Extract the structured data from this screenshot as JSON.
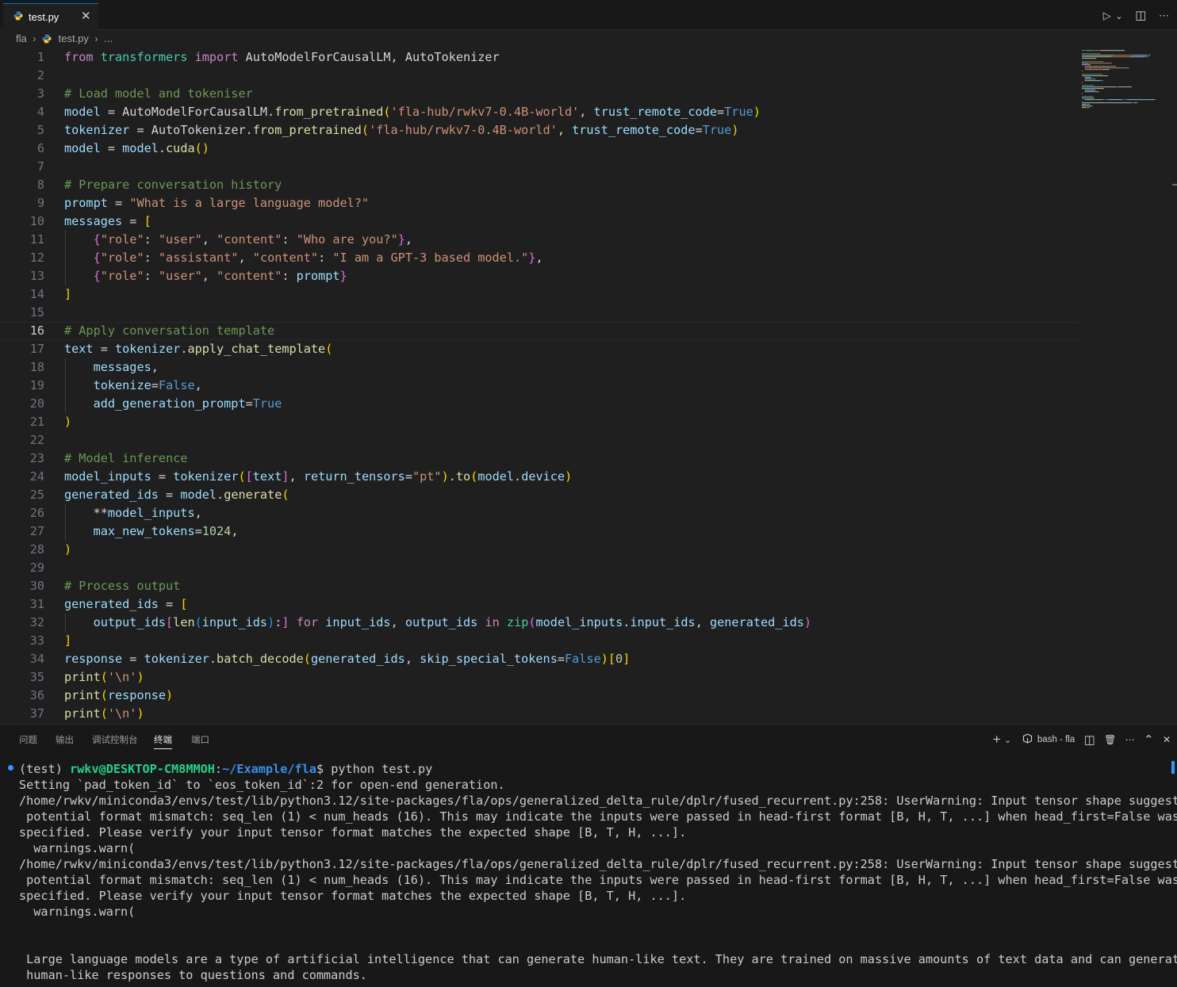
{
  "tab": {
    "filename": "test.py",
    "close_glyph": "✕"
  },
  "editor_actions": {
    "run": "▷",
    "run_menu": "⌄",
    "split": "◫",
    "more": "⋯"
  },
  "breadcrumb": {
    "folder": "fla",
    "file": "test.py",
    "more": "..."
  },
  "code_lines": [
    {
      "n": "1",
      "tokens": [
        [
          "kw",
          "from"
        ],
        [
          "plain",
          " "
        ],
        [
          "mod",
          "transformers"
        ],
        [
          "plain",
          " "
        ],
        [
          "kw",
          "import"
        ],
        [
          "plain",
          " "
        ],
        [
          "cls",
          "AutoModelForCausalLM"
        ],
        [
          "plain",
          ", "
        ],
        [
          "cls",
          "AutoTokenizer"
        ]
      ]
    },
    {
      "n": "2",
      "tokens": []
    },
    {
      "n": "3",
      "tokens": [
        [
          "cmt",
          "# Load model and tokeniser"
        ]
      ]
    },
    {
      "n": "4",
      "tokens": [
        [
          "var",
          "model"
        ],
        [
          "op",
          " = "
        ],
        [
          "cls",
          "AutoModelForCausalLM"
        ],
        [
          "plain",
          "."
        ],
        [
          "fn",
          "from_pretrained"
        ],
        [
          "b1",
          "("
        ],
        [
          "str",
          "'fla-hub/rwkv7-0.4B-world'"
        ],
        [
          "plain",
          ", "
        ],
        [
          "var",
          "trust_remote_code"
        ],
        [
          "op",
          "="
        ],
        [
          "bool",
          "True"
        ],
        [
          "b1",
          ")"
        ]
      ]
    },
    {
      "n": "5",
      "tokens": [
        [
          "var",
          "tokenizer"
        ],
        [
          "op",
          " = "
        ],
        [
          "cls",
          "AutoTokenizer"
        ],
        [
          "plain",
          "."
        ],
        [
          "fn",
          "from_pretrained"
        ],
        [
          "b1",
          "("
        ],
        [
          "str",
          "'fla-hub/rwkv7-0.4B-world'"
        ],
        [
          "plain",
          ", "
        ],
        [
          "var",
          "trust_remote_code"
        ],
        [
          "op",
          "="
        ],
        [
          "bool",
          "True"
        ],
        [
          "b1",
          ")"
        ]
      ]
    },
    {
      "n": "6",
      "tokens": [
        [
          "var",
          "model"
        ],
        [
          "op",
          " = "
        ],
        [
          "var",
          "model"
        ],
        [
          "plain",
          "."
        ],
        [
          "fn",
          "cuda"
        ],
        [
          "b1",
          "()"
        ]
      ]
    },
    {
      "n": "7",
      "tokens": []
    },
    {
      "n": "8",
      "tokens": [
        [
          "cmt",
          "# Prepare conversation history"
        ]
      ]
    },
    {
      "n": "9",
      "tokens": [
        [
          "var",
          "prompt"
        ],
        [
          "op",
          " = "
        ],
        [
          "str",
          "\"What is a large language model?\""
        ]
      ]
    },
    {
      "n": "10",
      "tokens": [
        [
          "var",
          "messages"
        ],
        [
          "op",
          " = "
        ],
        [
          "b1",
          "["
        ]
      ]
    },
    {
      "n": "11",
      "tokens": [
        [
          "plain",
          "    "
        ],
        [
          "b2",
          "{"
        ],
        [
          "str",
          "\"role\""
        ],
        [
          "plain",
          ": "
        ],
        [
          "str",
          "\"user\""
        ],
        [
          "plain",
          ", "
        ],
        [
          "str",
          "\"content\""
        ],
        [
          "plain",
          ": "
        ],
        [
          "str",
          "\"Who are you?\""
        ],
        [
          "b2",
          "}"
        ],
        [
          "plain",
          ","
        ]
      ]
    },
    {
      "n": "12",
      "tokens": [
        [
          "plain",
          "    "
        ],
        [
          "b2",
          "{"
        ],
        [
          "str",
          "\"role\""
        ],
        [
          "plain",
          ": "
        ],
        [
          "str",
          "\"assistant\""
        ],
        [
          "plain",
          ", "
        ],
        [
          "str",
          "\"content\""
        ],
        [
          "plain",
          ": "
        ],
        [
          "str",
          "\"I am a GPT-3 based model.\""
        ],
        [
          "b2",
          "}"
        ],
        [
          "plain",
          ","
        ]
      ]
    },
    {
      "n": "13",
      "tokens": [
        [
          "plain",
          "    "
        ],
        [
          "b2",
          "{"
        ],
        [
          "str",
          "\"role\""
        ],
        [
          "plain",
          ": "
        ],
        [
          "str",
          "\"user\""
        ],
        [
          "plain",
          ", "
        ],
        [
          "str",
          "\"content\""
        ],
        [
          "plain",
          ": "
        ],
        [
          "var",
          "prompt"
        ],
        [
          "b2",
          "}"
        ]
      ]
    },
    {
      "n": "14",
      "tokens": [
        [
          "b1",
          "]"
        ]
      ]
    },
    {
      "n": "15",
      "tokens": []
    },
    {
      "n": "16",
      "tokens": [
        [
          "cmt",
          "# Apply conversation template"
        ]
      ]
    },
    {
      "n": "17",
      "tokens": [
        [
          "var",
          "text"
        ],
        [
          "op",
          " = "
        ],
        [
          "var",
          "tokenizer"
        ],
        [
          "plain",
          "."
        ],
        [
          "fn",
          "apply_chat_template"
        ],
        [
          "b1",
          "("
        ]
      ]
    },
    {
      "n": "18",
      "tokens": [
        [
          "plain",
          "    "
        ],
        [
          "var",
          "messages"
        ],
        [
          "plain",
          ","
        ]
      ]
    },
    {
      "n": "19",
      "tokens": [
        [
          "plain",
          "    "
        ],
        [
          "var",
          "tokenize"
        ],
        [
          "op",
          "="
        ],
        [
          "bool",
          "False"
        ],
        [
          "plain",
          ","
        ]
      ]
    },
    {
      "n": "20",
      "tokens": [
        [
          "plain",
          "    "
        ],
        [
          "var",
          "add_generation_prompt"
        ],
        [
          "op",
          "="
        ],
        [
          "bool",
          "True"
        ]
      ]
    },
    {
      "n": "21",
      "tokens": [
        [
          "b1",
          ")"
        ]
      ]
    },
    {
      "n": "22",
      "tokens": []
    },
    {
      "n": "23",
      "tokens": [
        [
          "cmt",
          "# Model inference"
        ]
      ]
    },
    {
      "n": "24",
      "tokens": [
        [
          "var",
          "model_inputs"
        ],
        [
          "op",
          " = "
        ],
        [
          "var",
          "tokenizer"
        ],
        [
          "b1",
          "("
        ],
        [
          "b2",
          "["
        ],
        [
          "var",
          "text"
        ],
        [
          "b2",
          "]"
        ],
        [
          "plain",
          ", "
        ],
        [
          "var",
          "return_tensors"
        ],
        [
          "op",
          "="
        ],
        [
          "str",
          "\"pt\""
        ],
        [
          "b1",
          ")"
        ],
        [
          "plain",
          "."
        ],
        [
          "fn",
          "to"
        ],
        [
          "b1",
          "("
        ],
        [
          "var",
          "model"
        ],
        [
          "plain",
          "."
        ],
        [
          "var",
          "device"
        ],
        [
          "b1",
          ")"
        ]
      ]
    },
    {
      "n": "25",
      "tokens": [
        [
          "var",
          "generated_ids"
        ],
        [
          "op",
          " = "
        ],
        [
          "var",
          "model"
        ],
        [
          "plain",
          "."
        ],
        [
          "fn",
          "generate"
        ],
        [
          "b1",
          "("
        ]
      ]
    },
    {
      "n": "26",
      "tokens": [
        [
          "plain",
          "    "
        ],
        [
          "op",
          "**"
        ],
        [
          "var",
          "model_inputs"
        ],
        [
          "plain",
          ","
        ]
      ]
    },
    {
      "n": "27",
      "tokens": [
        [
          "plain",
          "    "
        ],
        [
          "var",
          "max_new_tokens"
        ],
        [
          "op",
          "="
        ],
        [
          "num",
          "1024"
        ],
        [
          "plain",
          ","
        ]
      ]
    },
    {
      "n": "28",
      "tokens": [
        [
          "b1",
          ")"
        ]
      ]
    },
    {
      "n": "29",
      "tokens": []
    },
    {
      "n": "30",
      "tokens": [
        [
          "cmt",
          "# Process output"
        ]
      ]
    },
    {
      "n": "31",
      "tokens": [
        [
          "var",
          "generated_ids"
        ],
        [
          "op",
          " = "
        ],
        [
          "b1",
          "["
        ]
      ]
    },
    {
      "n": "32",
      "tokens": [
        [
          "plain",
          "    "
        ],
        [
          "var",
          "output_ids"
        ],
        [
          "b2",
          "["
        ],
        [
          "fn",
          "len"
        ],
        [
          "b3",
          "("
        ],
        [
          "var",
          "input_ids"
        ],
        [
          "b3",
          ")"
        ],
        [
          "plain",
          ":"
        ],
        [
          "b2",
          "]"
        ],
        [
          "plain",
          " "
        ],
        [
          "kw",
          "for"
        ],
        [
          "plain",
          " "
        ],
        [
          "var",
          "input_ids"
        ],
        [
          "plain",
          ", "
        ],
        [
          "var",
          "output_ids"
        ],
        [
          "plain",
          " "
        ],
        [
          "kw",
          "in"
        ],
        [
          "plain",
          " "
        ],
        [
          "mod",
          "zip"
        ],
        [
          "b2",
          "("
        ],
        [
          "var",
          "model_inputs"
        ],
        [
          "plain",
          "."
        ],
        [
          "var",
          "input_ids"
        ],
        [
          "plain",
          ", "
        ],
        [
          "var",
          "generated_ids"
        ],
        [
          "b2",
          ")"
        ]
      ]
    },
    {
      "n": "33",
      "tokens": [
        [
          "b1",
          "]"
        ]
      ]
    },
    {
      "n": "34",
      "tokens": [
        [
          "var",
          "response"
        ],
        [
          "op",
          " = "
        ],
        [
          "var",
          "tokenizer"
        ],
        [
          "plain",
          "."
        ],
        [
          "fn",
          "batch_decode"
        ],
        [
          "b1",
          "("
        ],
        [
          "var",
          "generated_ids"
        ],
        [
          "plain",
          ", "
        ],
        [
          "var",
          "skip_special_tokens"
        ],
        [
          "op",
          "="
        ],
        [
          "bool",
          "False"
        ],
        [
          "b1",
          ")"
        ],
        [
          "b1",
          "["
        ],
        [
          "num",
          "0"
        ],
        [
          "b1",
          "]"
        ]
      ]
    },
    {
      "n": "35",
      "tokens": [
        [
          "fn",
          "print"
        ],
        [
          "b1",
          "("
        ],
        [
          "str",
          "'\\n'"
        ],
        [
          "b1",
          ")"
        ]
      ]
    },
    {
      "n": "36",
      "tokens": [
        [
          "fn",
          "print"
        ],
        [
          "b1",
          "("
        ],
        [
          "var",
          "response"
        ],
        [
          "b1",
          ")"
        ]
      ]
    },
    {
      "n": "37",
      "tokens": [
        [
          "fn",
          "print"
        ],
        [
          "b1",
          "("
        ],
        [
          "str",
          "'\\n'"
        ],
        [
          "b1",
          ")"
        ]
      ]
    }
  ],
  "active_line": "16",
  "panel": {
    "tabs": [
      "问题",
      "输出",
      "调试控制台",
      "终端",
      "端口"
    ],
    "active_tab": "终端",
    "actions": {
      "add": "+",
      "add_menu": "⌄",
      "shell_label": "bash - fla",
      "split": "◫",
      "trash": "🗑",
      "more": "⋯",
      "maximize": "⌃",
      "close": "✕"
    }
  },
  "terminal": {
    "prompt_env": "(test) ",
    "prompt_user": "rwkv@DESKTOP-CM8MMOH",
    "prompt_colon": ":",
    "prompt_path": "~/Example/fla",
    "prompt_symbol": "$ ",
    "command": "python test.py",
    "lines": [
      "Setting `pad_token_id` to `eos_token_id`:2 for open-end generation.",
      "/home/rwkv/miniconda3/envs/test/lib/python3.12/site-packages/fla/ops/generalized_delta_rule/dplr/fused_recurrent.py:258: UserWarning: Input tensor shape suggests",
      " potential format mismatch: seq_len (1) < num_heads (16). This may indicate the inputs were passed in head-first format [B, H, T, ...] when head_first=False was",
      "specified. Please verify your input tensor format matches the expected shape [B, T, H, ...].",
      "  warnings.warn(",
      "/home/rwkv/miniconda3/envs/test/lib/python3.12/site-packages/fla/ops/generalized_delta_rule/dplr/fused_recurrent.py:258: UserWarning: Input tensor shape suggests",
      " potential format mismatch: seq_len (1) < num_heads (16). This may indicate the inputs were passed in head-first format [B, H, T, ...] when head_first=False was",
      "specified. Please verify your input tensor format matches the expected shape [B, T, H, ...].",
      "  warnings.warn(",
      "",
      "",
      " Large language models are a type of artificial intelligence that can generate human-like text. They are trained on massive amounts of text data and can generate",
      " human-like responses to questions and commands."
    ]
  }
}
